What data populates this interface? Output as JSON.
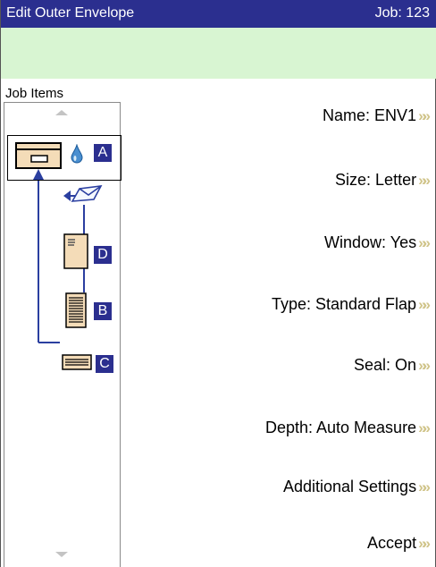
{
  "header": {
    "title": "Edit Outer Envelope",
    "job": "Job: 123"
  },
  "panel": {
    "label": "Job Items",
    "items": [
      {
        "letter": "A",
        "icon": "envelope-icon"
      },
      {
        "letter": "D",
        "icon": "document-icon"
      },
      {
        "letter": "B",
        "icon": "document-stack-icon"
      },
      {
        "letter": "C",
        "icon": "reply-envelope-icon"
      }
    ]
  },
  "settings": {
    "name": "Name:  ENV1",
    "size": "Size:  Letter",
    "window": "Window:  Yes",
    "type": "Type:  Standard Flap",
    "seal": "Seal:  On",
    "depth": "Depth:  Auto Measure",
    "additional": "Additional Settings",
    "accept": "Accept"
  },
  "colors": {
    "header": "#2b2f8f",
    "status_bar": "#d8f5d2",
    "chevron": "#d0c48a",
    "tree_line": "#2b3fa0",
    "envelope": "#f4dcb8"
  },
  "icons": {
    "chevron": "double-chevron-right-icon",
    "ink": "ink-drop-icon",
    "insert": "insert-envelope-icon"
  }
}
